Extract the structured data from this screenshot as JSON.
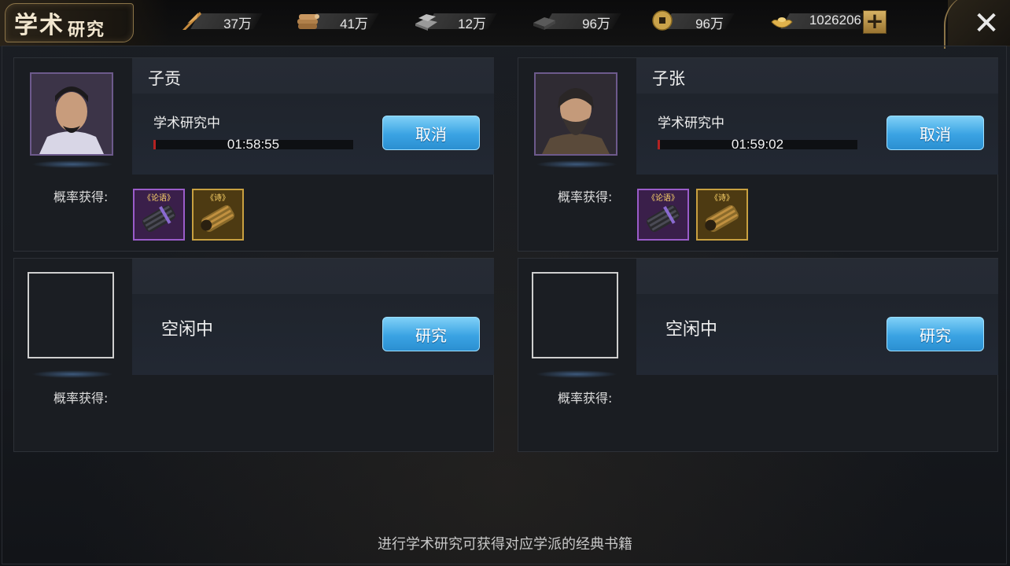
{
  "window": {
    "title_big": "学术",
    "title_small": "研究",
    "close_label": "✕"
  },
  "resources": [
    {
      "icon": "quill-icon",
      "value": "37万"
    },
    {
      "icon": "wood-icon",
      "value": "41万"
    },
    {
      "icon": "stone-icon",
      "value": "12万"
    },
    {
      "icon": "iron-icon",
      "value": "96万"
    },
    {
      "icon": "coin-icon",
      "value": "96万"
    },
    {
      "icon": "gold-ingot-icon",
      "value": "1026206"
    }
  ],
  "add_label": "+",
  "slots": [
    {
      "name": "子贡",
      "status": "学术研究中",
      "timer": "01:58:55",
      "progress": 0.01,
      "button": "取消",
      "reward_label": "概率获得:",
      "items": [
        {
          "tag": "《论语》",
          "rarity": "purple",
          "icon": "scroll-bundle-icon"
        },
        {
          "tag": "《诗》",
          "rarity": "gold",
          "icon": "scroll-bundle-icon"
        }
      ]
    },
    {
      "name": "子张",
      "status": "学术研究中",
      "timer": "01:59:02",
      "progress": 0.01,
      "button": "取消",
      "reward_label": "概率获得:",
      "items": [
        {
          "tag": "《论语》",
          "rarity": "purple",
          "icon": "scroll-bundle-icon"
        },
        {
          "tag": "《诗》",
          "rarity": "gold",
          "icon": "scroll-bundle-icon"
        }
      ]
    },
    {
      "status": "空闲中",
      "button": "研究",
      "reward_label": "概率获得:"
    },
    {
      "status": "空闲中",
      "button": "研究",
      "reward_label": "概率获得:"
    }
  ],
  "footer_tip": "进行学术研究可获得对应学派的经典书籍",
  "colors": {
    "button_blue": "#3aa3e3",
    "progress_red": "#b32222",
    "rarity_purple": "#9a5cc9",
    "rarity_gold": "#c8a040"
  }
}
